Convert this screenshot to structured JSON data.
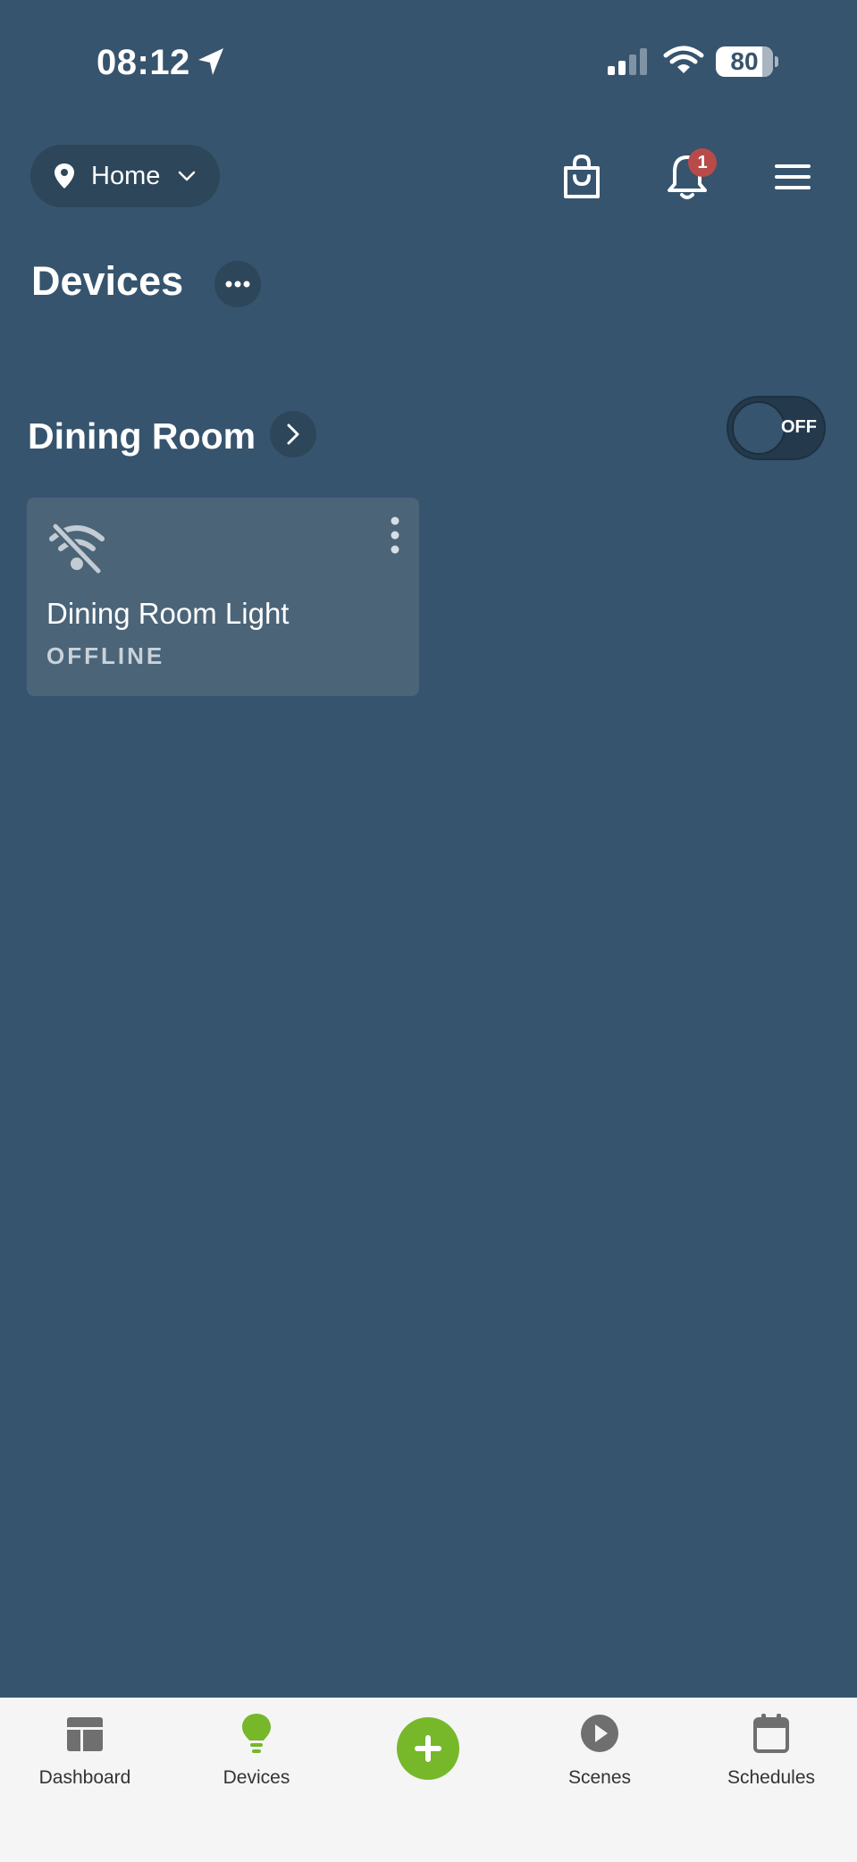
{
  "status_bar": {
    "time": "08:12",
    "battery": "80",
    "icons": [
      "location-arrow-icon",
      "signal-icon",
      "wifi-icon",
      "battery-icon"
    ]
  },
  "header": {
    "location_label": "Home",
    "icons": [
      "map-pin-icon",
      "chevron-down-icon",
      "shopping-bag-icon",
      "bell-icon",
      "hamburger-menu-icon"
    ],
    "notification_count": "1"
  },
  "page": {
    "title": "Devices"
  },
  "room": {
    "name": "Dining Room",
    "toggle_state": "OFF",
    "devices": [
      {
        "name": "Dining Room Light",
        "status": "OFFLINE",
        "icon": "wifi-off-icon"
      }
    ]
  },
  "tab_bar": {
    "tabs": [
      {
        "label": "Dashboard",
        "icon": "dashboard-icon",
        "active": false
      },
      {
        "label": "Devices",
        "icon": "lightbulb-icon",
        "active": true
      },
      {
        "label": "Scenes",
        "icon": "play-circle-icon",
        "active": false
      },
      {
        "label": "Schedules",
        "icon": "calendar-icon",
        "active": false
      }
    ],
    "add_icon": "plus-icon"
  },
  "colors": {
    "background": "#36546e",
    "card": "#4b6478",
    "accent_green": "#76b82a",
    "badge_red": "#b94a4a",
    "tab_bar_bg": "#f5f5f5"
  }
}
